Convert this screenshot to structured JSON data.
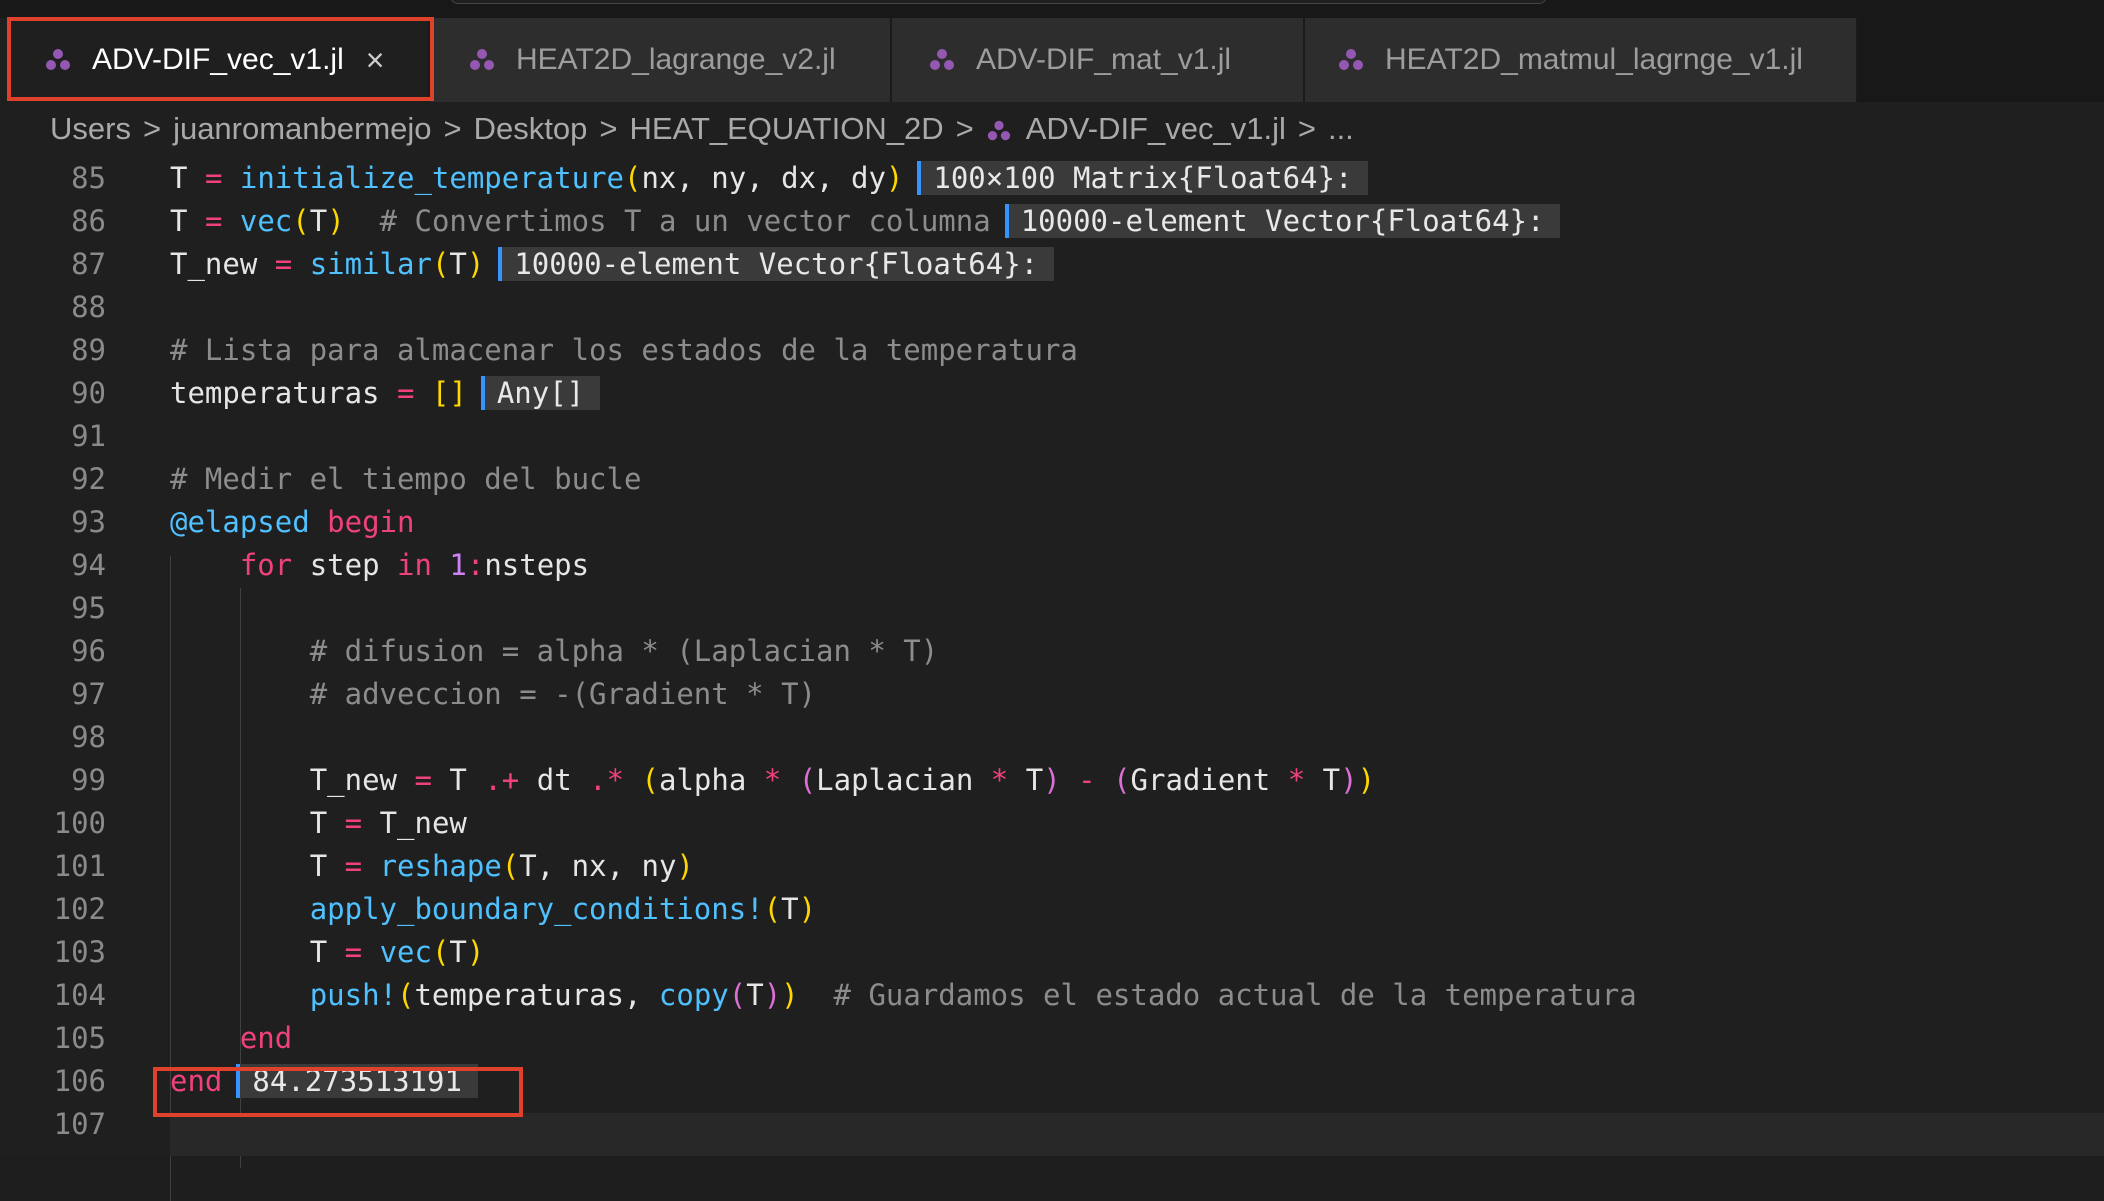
{
  "tabs": [
    {
      "label": "ADV-DIF_vec_v1.jl",
      "active": true
    },
    {
      "label": "HEAT2D_lagrange_v2.jl",
      "active": false
    },
    {
      "label": "ADV-DIF_mat_v1.jl",
      "active": false
    },
    {
      "label": "HEAT2D_matmul_lagrnge_v1.jl",
      "active": false
    }
  ],
  "tab_close_glyph": "×",
  "breadcrumb": [
    "Users",
    "juanromanbermejo",
    "Desktop",
    "HEAT_EQUATION_2D",
    "ADV-DIF_vec_v1.jl",
    "..."
  ],
  "breadcrumb_sep": ">",
  "colors": {
    "accent": "#3794ff",
    "highlight": "#e0412a",
    "julia_dot": "#9558b2"
  },
  "icons": {
    "file": "julia-file-icon",
    "close": "close-icon"
  },
  "lines": {
    "n85": "85",
    "n86": "86",
    "n87": "87",
    "n88": "88",
    "n89": "89",
    "n90": "90",
    "n91": "91",
    "n92": "92",
    "n93": "93",
    "n94": "94",
    "n95": "95",
    "n96": "96",
    "n97": "97",
    "n98": "98",
    "n99": "99",
    "n100": "100",
    "n101": "101",
    "n102": "102",
    "n103": "103",
    "n104": "104",
    "n105": "105",
    "n106": "106",
    "n107": "107"
  },
  "tok": {
    "T": "T",
    "eq": "=",
    "init_fn": "initialize_temperature",
    "lp": "(",
    "rp": ")",
    "nx": "nx",
    "ny": "ny",
    "dx": "dx",
    "dy": "dy",
    "comma": ", ",
    "vec": "vec",
    "similar": "similar",
    "T_new": "T_new",
    "c86": "# Convertimos T a un vector columna",
    "c89": "# Lista para almacenar los estados de la temperatura",
    "temperaturas": "temperaturas",
    "empty": "[]",
    "c92": "# Medir el tiempo del bucle",
    "elapsed": "@elapsed",
    "begin": "begin",
    "for": "for",
    "step": "step",
    "in": "in",
    "one": "1",
    "colon": ":",
    "nsteps": "nsteps",
    "c96": "# difusion = alpha * (Laplacian * T)",
    "c97": "# adveccion = -(Gradient * T)",
    "dotplus": ".+",
    "dt": "dt",
    "dotstar": ".*",
    "alpha": "alpha",
    "star": "*",
    "Laplacian": "Laplacian",
    "minus": "-",
    "Gradient": "Gradient",
    "reshape": "reshape",
    "apply_bc": "apply_boundary_conditions!",
    "push": "push!",
    "copy": "copy",
    "c104": "# Guardamos el estado actual de la temperatura",
    "end": "end"
  },
  "results": {
    "r85": "100×100 Matrix{Float64}:",
    "r86": "10000-element Vector{Float64}:",
    "r87": "10000-element Vector{Float64}:",
    "r90": "Any[]",
    "r106": "84.273513191"
  }
}
